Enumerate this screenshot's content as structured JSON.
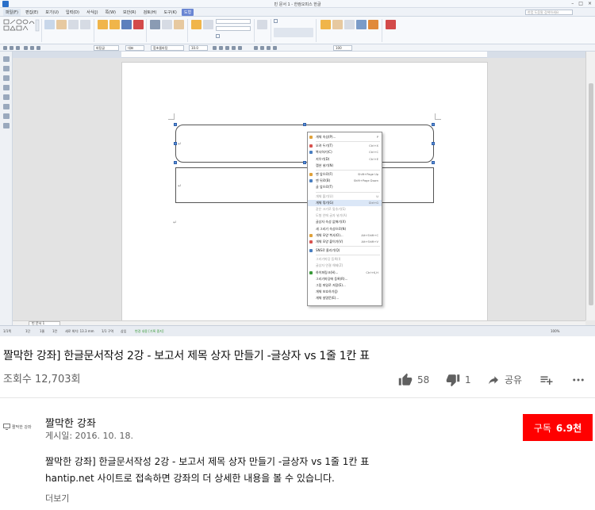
{
  "app": {
    "window_title": "빈 문서 1 - 한컴오피스 한글",
    "help_search_placeholder": "한컴 도움말 검색하세요",
    "menu": [
      {
        "label": "파일(F)",
        "type": "file"
      },
      {
        "label": "편집(E)",
        "type": ""
      },
      {
        "label": "보기(U)",
        "type": ""
      },
      {
        "label": "입력(D)",
        "type": ""
      },
      {
        "label": "서식(J)",
        "type": ""
      },
      {
        "label": "쪽(W)",
        "type": ""
      },
      {
        "label": "보안(R)",
        "type": ""
      },
      {
        "label": "검토(H)",
        "type": ""
      },
      {
        "label": "도구(K)",
        "type": ""
      },
      {
        "label": "도형",
        "type": "active"
      }
    ],
    "format_toolbar": {
      "style": "바탕글",
      "lang": "대표",
      "font": "함초롬바탕",
      "size": "10.0",
      "zoom": "100"
    },
    "doc_tab": "빈 문서 1",
    "status": {
      "page": "1/1쪽",
      "section": "1단",
      "line": "1줄",
      "col": "1칸",
      "position": "세로 위치: 13.3 mm",
      "insert": "1/1 구역",
      "mode": "삽입",
      "change": "변경 내용 [기록 중지]",
      "zoom": "100%"
    },
    "context_menu": [
      {
        "label": "개체 속성(P)...",
        "shortcut": "P",
        "state": "normal",
        "icon": "#e0a13a"
      },
      {
        "sep": true
      },
      {
        "label": "오려 두기(T)",
        "shortcut": "Ctrl+X",
        "state": "normal",
        "icon": "#d9534f"
      },
      {
        "label": "복사하기(C)",
        "shortcut": "Ctrl+C",
        "state": "normal",
        "icon": "#4a7fc1"
      },
      {
        "label": "지우기(D)",
        "shortcut": "Ctrl+E",
        "state": "normal",
        "icon": ""
      },
      {
        "label": "캡션 넣기(N)",
        "shortcut": "",
        "state": "normal",
        "icon": ""
      },
      {
        "sep": true
      },
      {
        "label": "맨 앞으로(F)",
        "shortcut": "Shift+Page Up",
        "state": "normal",
        "icon": "#e0a13a"
      },
      {
        "label": "맨 뒤로(B)",
        "shortcut": "Shift+Page Down",
        "state": "normal",
        "icon": "#4a7fc1"
      },
      {
        "label": "글 앞으로(T)",
        "shortcut": "",
        "state": "normal",
        "icon": ""
      },
      {
        "sep": true
      },
      {
        "label": "개체 풀기(U)",
        "shortcut": "U",
        "state": "disabled",
        "icon": ""
      },
      {
        "label": "개체 묶기(G)",
        "shortcut": "Ctrl+G",
        "state": "highlight",
        "icon": ""
      },
      {
        "label": "같은 크기로 맞추기(S)",
        "shortcut": "",
        "state": "disabled",
        "icon": ""
      },
      {
        "label": "도형 안에 글자 넣기(A)",
        "shortcut": "",
        "state": "disabled",
        "icon": ""
      },
      {
        "label": "글상자 속성 없애기(X)",
        "shortcut": "",
        "state": "normal",
        "icon": ""
      },
      {
        "label": "새 그리기 속성으로(N)",
        "shortcut": "",
        "state": "normal",
        "icon": ""
      },
      {
        "label": "개체 모양 복사(O)...",
        "shortcut": "Alt+Shift+C",
        "state": "normal",
        "icon": "#e0a13a"
      },
      {
        "label": "개체 모양 붙이기(V)",
        "shortcut": "Alt+Shift+V",
        "state": "normal",
        "icon": "#d9534f"
      },
      {
        "sep": true
      },
      {
        "label": "SNS로 올리기(Q)",
        "shortcut": "",
        "state": "normal",
        "icon": "#4a7fc1"
      },
      {
        "sep": true
      },
      {
        "label": "그리기마당 등록(I)",
        "shortcut": "",
        "state": "disabled",
        "icon": ""
      },
      {
        "label": "글상자 연결 해제(Z)",
        "shortcut": "",
        "state": "disabled",
        "icon": ""
      },
      {
        "label": "하이퍼링크(H)...",
        "shortcut": "Ctrl+K,H",
        "state": "normal",
        "icon": "#3a9a3a"
      },
      {
        "label": "그리기마당에 등록(R)...",
        "shortcut": "",
        "state": "normal",
        "icon": ""
      },
      {
        "label": "그림 파일로 저장(E)...",
        "shortcut": "",
        "state": "normal",
        "icon": ""
      },
      {
        "label": "개체 보호하기(J)",
        "shortcut": "",
        "state": "normal",
        "icon": ""
      },
      {
        "label": "개체 설명문(E)...",
        "shortcut": "",
        "state": "normal",
        "icon": ""
      }
    ]
  },
  "video": {
    "title": "짤막한 강좌] 한글문서작성 2강 - 보고서 제목 상자 만들기 -글상자 vs 1줄 1칸 표",
    "views": "조회수 12,703회",
    "likes": "58",
    "dislikes": "1",
    "share_label": "공유",
    "save_icon": "playlist-add-icon",
    "more_icon": "more-horizontal-icon"
  },
  "channel": {
    "name": "짤막한 강좌",
    "avatar_text": "짤막한 강좌",
    "date": "게시일: 2016. 10. 18.",
    "subscribe_label": "구독",
    "subscriber_count": "6.9천"
  },
  "description": {
    "line1": "짤막한 강좌] 한글문서작성 2강 - 보고서 제목 상자 만들기 -글상자 vs 1줄 1칸 표",
    "line2": "hantip.net 사이트로 접속하면 강좌의 더 상세한 내용을 볼 수 있습니다.",
    "more_label": "더보기"
  },
  "colors": {
    "subscribe": "#ff0000",
    "ribbon_active_tab": "#6a86d3",
    "text_secondary": "#606060"
  }
}
